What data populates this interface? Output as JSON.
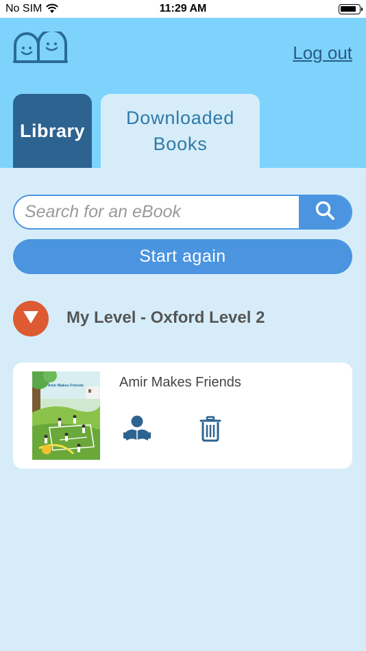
{
  "status_bar": {
    "carrier": "No SIM",
    "time": "11:29 AM"
  },
  "header": {
    "logout_label": "Log out",
    "tabs": [
      {
        "label": "Library",
        "active": false
      },
      {
        "label": "Downloaded Books",
        "active": true
      }
    ]
  },
  "search": {
    "placeholder": "Search for an eBook",
    "value": ""
  },
  "start_again_label": "Start again",
  "level": {
    "title": "My Level - Oxford Level 2"
  },
  "books": [
    {
      "title": "Amir Makes Friends",
      "cover_title": "Amir Makes Friends"
    }
  ],
  "colors": {
    "header_bg": "#7dd3fc",
    "page_bg": "#d6edf9",
    "tab_dark": "#2d6390",
    "accent_blue": "#4a94e0",
    "level_toggle": "#dd5a32"
  },
  "icons": {
    "logo": "two-smiling-faces-logo",
    "search": "search-icon",
    "level_toggle": "triangle-down-icon",
    "read": "reader-icon",
    "delete": "trash-icon"
  }
}
